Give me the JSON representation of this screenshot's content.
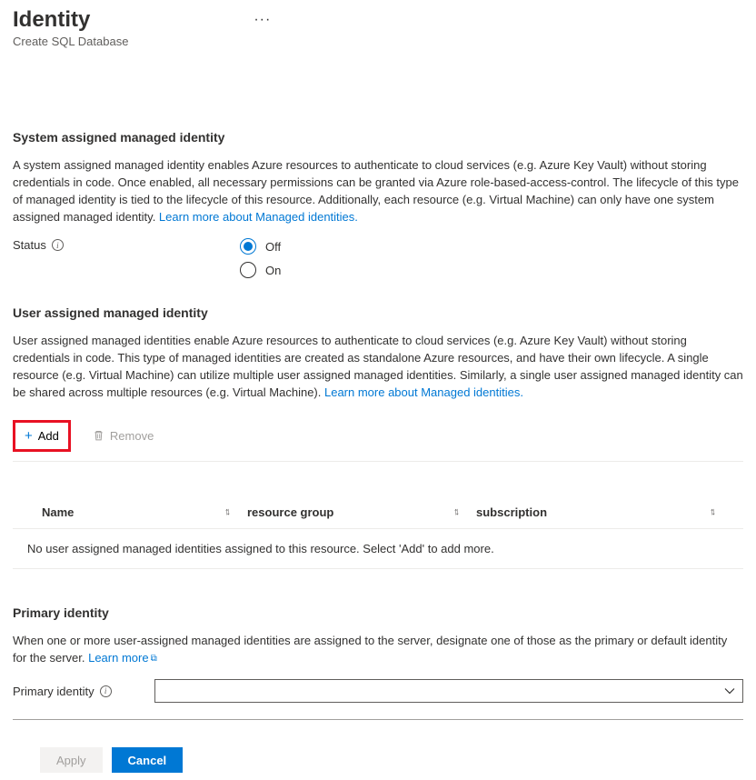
{
  "header": {
    "title": "Identity",
    "subtitle": "Create SQL Database"
  },
  "system": {
    "heading": "System assigned managed identity",
    "desc": "A system assigned managed identity enables Azure resources to authenticate to cloud services (e.g. Azure Key Vault) without storing credentials in code. Once enabled, all necessary permissions can be granted via Azure role-based-access-control. The lifecycle of this type of managed identity is tied to the lifecycle of this resource. Additionally, each resource (e.g. Virtual Machine) can only have one system assigned managed identity. ",
    "learn_more": "Learn more about Managed identities.",
    "status_label": "Status",
    "off": "Off",
    "on": "On"
  },
  "user": {
    "heading": "User assigned managed identity",
    "desc": "User assigned managed identities enable Azure resources to authenticate to cloud services (e.g. Azure Key Vault) without storing credentials in code. This type of managed identities are created as standalone Azure resources, and have their own lifecycle. A single resource (e.g. Virtual Machine) can utilize multiple user assigned managed identities. Similarly, a single user assigned managed identity can be shared across multiple resources (e.g. Virtual Machine). ",
    "learn_more": "Learn more about Managed identities.",
    "add_label": "Add",
    "remove_label": "Remove",
    "columns": {
      "name": "Name",
      "rg": "resource group",
      "sub": "subscription"
    },
    "empty_text": "No user assigned managed identities assigned to this resource. Select 'Add' to add more."
  },
  "primary": {
    "heading": "Primary identity",
    "desc_pre": "When one or more user-assigned managed identities are assigned to the server, designate one of those as the primary or default identity for the server. ",
    "learn_more": "Learn more",
    "field_label": "Primary identity"
  },
  "footer": {
    "apply": "Apply",
    "cancel": "Cancel"
  }
}
